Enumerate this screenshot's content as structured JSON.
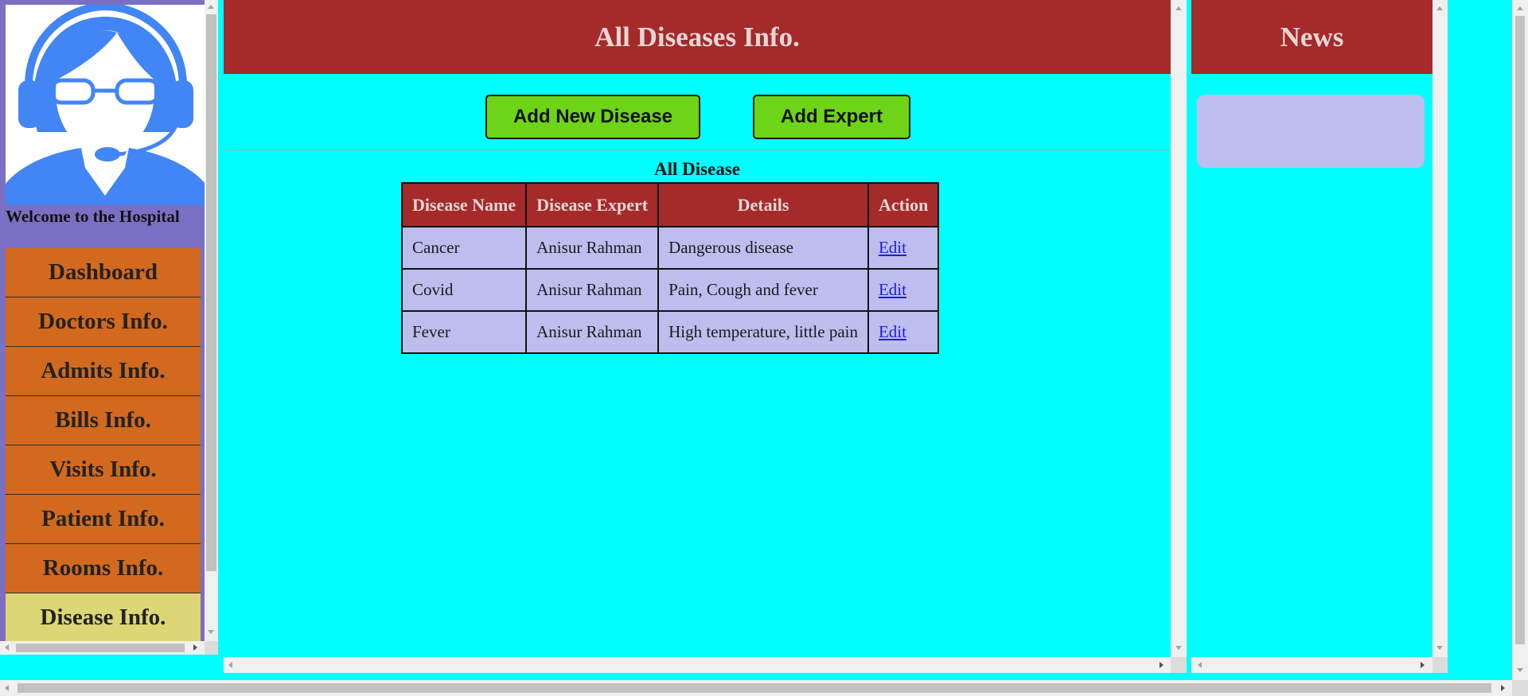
{
  "sidebar": {
    "welcome": "Welcome to the Hospital",
    "items": [
      {
        "label": "Dashboard"
      },
      {
        "label": "Doctors Info."
      },
      {
        "label": "Admits Info."
      },
      {
        "label": "Bills Info."
      },
      {
        "label": "Visits Info."
      },
      {
        "label": "Patient Info."
      },
      {
        "label": "Rooms Info."
      },
      {
        "label": "Disease Info."
      }
    ],
    "active_item": "Disease Info."
  },
  "main": {
    "title": "All Diseases Info.",
    "buttons": {
      "add_disease": "Add New Disease",
      "add_expert": "Add Expert"
    },
    "table_caption": "All Disease",
    "table": {
      "headers": [
        "Disease Name",
        "Disease Expert",
        "Details",
        "Action"
      ],
      "rows": [
        [
          "Cancer",
          "Anisur Rahman",
          "Dangerous disease",
          "Edit"
        ],
        [
          "Covid",
          "Anisur Rahman",
          "Pain, Cough and fever",
          "Edit"
        ],
        [
          "Fever",
          "Anisur Rahman",
          "High temperature, little pain",
          "Edit"
        ]
      ]
    }
  },
  "news": {
    "title": "News"
  },
  "colors": {
    "page_background": "#00ffff",
    "header": "#a52a2a",
    "nav_item": "#d2691e",
    "nav_active": "#dcd676",
    "sidebar": "#7b6fc3",
    "button": "#6ed417",
    "table_cell": "#bdbdee"
  },
  "icons": {
    "avatar": "support-agent-avatar-icon"
  }
}
